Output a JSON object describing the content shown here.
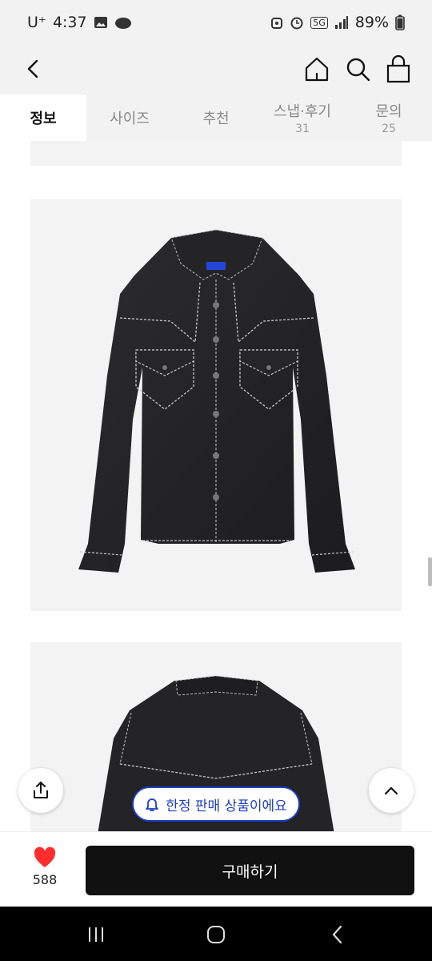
{
  "status": {
    "carrier": "U⁺",
    "time": "4:37",
    "network": "5G",
    "battery": "89%"
  },
  "header": {
    "back": "back-arrow-icon",
    "icons": [
      "home-icon",
      "search-icon",
      "shopping-bag-icon"
    ]
  },
  "tabs": [
    {
      "label": "정보",
      "count": ""
    },
    {
      "label": "사이즈",
      "count": ""
    },
    {
      "label": "추천",
      "count": ""
    },
    {
      "label": "스냅·후기",
      "count": "31"
    },
    {
      "label": "문의",
      "count": "25"
    }
  ],
  "notice": {
    "label": "한정 판매 상품이에요",
    "icon": "bell-icon",
    "color": "#1e3fc4"
  },
  "floating": {
    "share": "share-icon",
    "top": "chevron-up-icon"
  },
  "bottom": {
    "like_count": "588",
    "like_color": "#ff2d2d",
    "buy_label": "구매하기"
  },
  "nav": {
    "items": [
      "recent-apps-icon",
      "home-nav-icon",
      "back-nav-icon"
    ]
  }
}
